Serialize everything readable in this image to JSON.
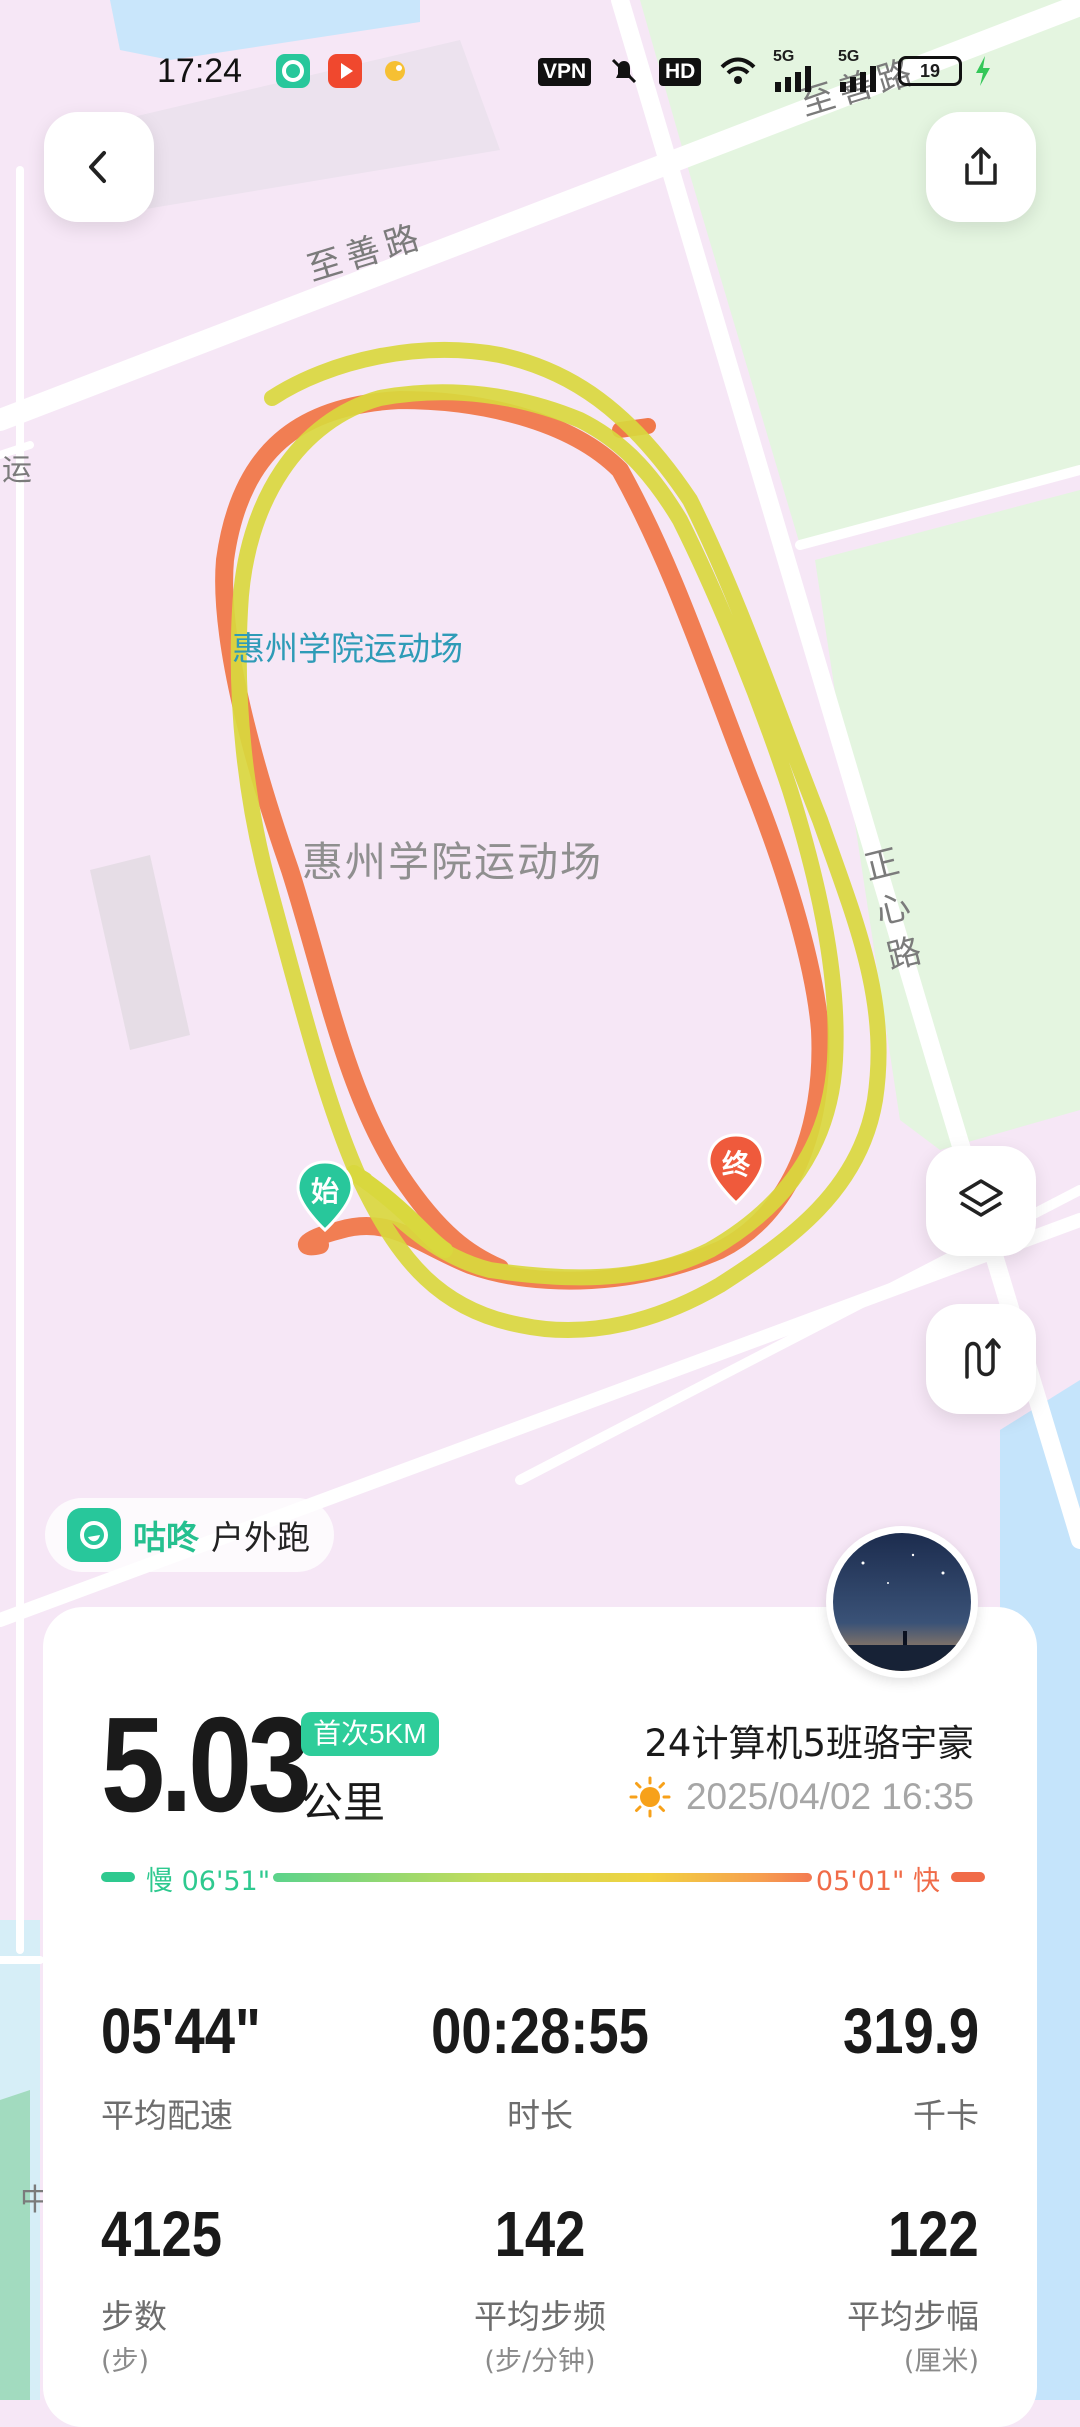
{
  "status_bar": {
    "time": "17:24",
    "vpn": "VPN",
    "hd": "HD",
    "net1": "5G",
    "net2": "5G",
    "battery": "19"
  },
  "map": {
    "road_top": "至善路",
    "road_top_right": "至善路",
    "road_right": "正心路",
    "left_edge_char": "运",
    "bottom_left_char": "中",
    "venue_label_blue": "惠州学院运动场",
    "venue_label_gray": "惠州学院运动场",
    "start_marker": "始",
    "end_marker": "终"
  },
  "brand": {
    "app_name": "咕咚",
    "mode": "户外跑"
  },
  "summary": {
    "distance": "5.03",
    "distance_unit": "公里",
    "badge": "首次5KM",
    "user_name": "24计算机5班骆宇豪",
    "datetime": "2025/04/02 16:35",
    "pace_slow": "慢 06'51\"",
    "pace_fast": "05'01\" 快"
  },
  "stats": {
    "avg_pace": {
      "value": "05'44\"",
      "label": "平均配速"
    },
    "duration": {
      "value": "00:28:55",
      "label": "时长"
    },
    "calories": {
      "value": "319.9",
      "label": "千卡"
    },
    "steps": {
      "value": "4125",
      "label": "步数",
      "unit": "(步)"
    },
    "cadence": {
      "value": "142",
      "label": "平均步频",
      "unit": "(步/分钟)"
    },
    "stride": {
      "value": "122",
      "label": "平均步幅",
      "unit": "(厘米)"
    }
  },
  "colors": {
    "track_yellow": "#d9d83e",
    "track_orange": "#f0784a",
    "accent_green": "#2ecd9a",
    "map_bg": "#f6e7f6",
    "park_green": "#e4f5e0"
  }
}
